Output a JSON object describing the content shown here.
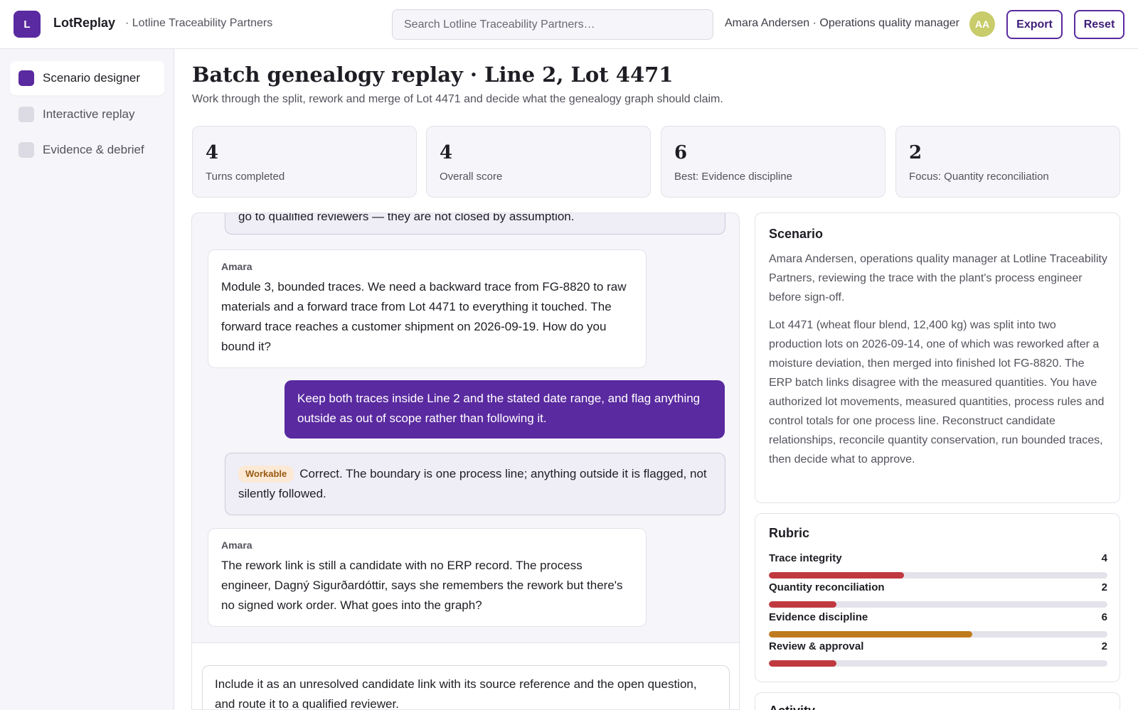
{
  "app": {
    "logo_letter": "L",
    "name": "LotReplay",
    "org": "· Lotline Traceability Partners"
  },
  "search": {
    "placeholder": "Search Lotline Traceability Partners…"
  },
  "user": {
    "label": "Amara Andersen · Operations quality manager",
    "initials": "AA"
  },
  "toolbar": {
    "export_label": "Export",
    "reset_label": "Reset"
  },
  "sidebar": {
    "items": [
      {
        "label": "Scenario designer",
        "active": true
      },
      {
        "label": "Interactive replay",
        "active": false
      },
      {
        "label": "Evidence & debrief",
        "active": false
      }
    ]
  },
  "page": {
    "title": "Batch genealogy replay · Line 2, Lot 4471",
    "subtitle": "Work through the split, rework and merge of Lot 4471 and decide what the genealogy graph should claim."
  },
  "stats": [
    {
      "value": "4",
      "label": "Turns completed"
    },
    {
      "value": "4",
      "label": "Overall score"
    },
    {
      "value": "6",
      "label": "Best: Evidence discipline"
    },
    {
      "value": "2",
      "label": "Focus: Quantity reconciliation"
    }
  ],
  "chat": {
    "messages": [
      {
        "type": "feedback-partial",
        "text": "go to qualified reviewers — they are not closed by assumption."
      },
      {
        "type": "amara",
        "speaker": "Amara",
        "text": "Module 3, bounded traces. We need a backward trace from FG-8820 to raw materials and a forward trace from Lot 4471 to everything it touched. The forward trace reaches a customer shipment on 2026-09-19. How do you bound it?"
      },
      {
        "type": "user",
        "text": "Keep both traces inside Line 2 and the stated date range, and flag anything outside as out of scope rather than following it."
      },
      {
        "type": "feedback",
        "badge": "Workable",
        "text": "Correct. The boundary is one process line; anything outside it is flagged, not silently followed."
      },
      {
        "type": "amara",
        "speaker": "Amara",
        "text": "The rework link is still a candidate with no ERP record. The process engineer, Dagný Sigurðardóttir, says she remembers the rework but there's no signed work order. What goes into the graph?"
      }
    ],
    "draft": "Include it as an unresolved candidate link with its source reference and the open question, and route it to a qualified reviewer."
  },
  "scenario": {
    "title": "Scenario",
    "intro": "Amara Andersen, operations quality manager at Lotline Traceability Partners, reviewing the trace with the plant's process engineer before sign-off.",
    "body": "Lot 4471 (wheat flour blend, 12,400 kg) was split into two production lots on 2026-09-14, one of which was reworked after a moisture deviation, then merged into finished lot FG-8820. The ERP batch links disagree with the measured quantities. You have authorized lot movements, measured quantities, process rules and control totals for one process line. Reconstruct candidate relationships, reconcile quantity conservation, run bounded traces, then decide what to approve."
  },
  "rubric": {
    "title": "Rubric",
    "max": 10,
    "items": [
      {
        "name": "Trace integrity",
        "value": "4",
        "score": 4,
        "color": "#c0393f"
      },
      {
        "name": "Quantity reconciliation",
        "value": "2",
        "score": 2,
        "color": "#c0393f"
      },
      {
        "name": "Evidence discipline",
        "value": "6",
        "score": 6,
        "color": "#c07a1e"
      },
      {
        "name": "Review & approval",
        "value": "2",
        "score": 2,
        "color": "#c0393f"
      }
    ]
  },
  "activity": {
    "title": "Activity"
  },
  "colors": {
    "accent": "#5a2aa0",
    "warn": "#c07a1e",
    "bad": "#c0393f"
  }
}
